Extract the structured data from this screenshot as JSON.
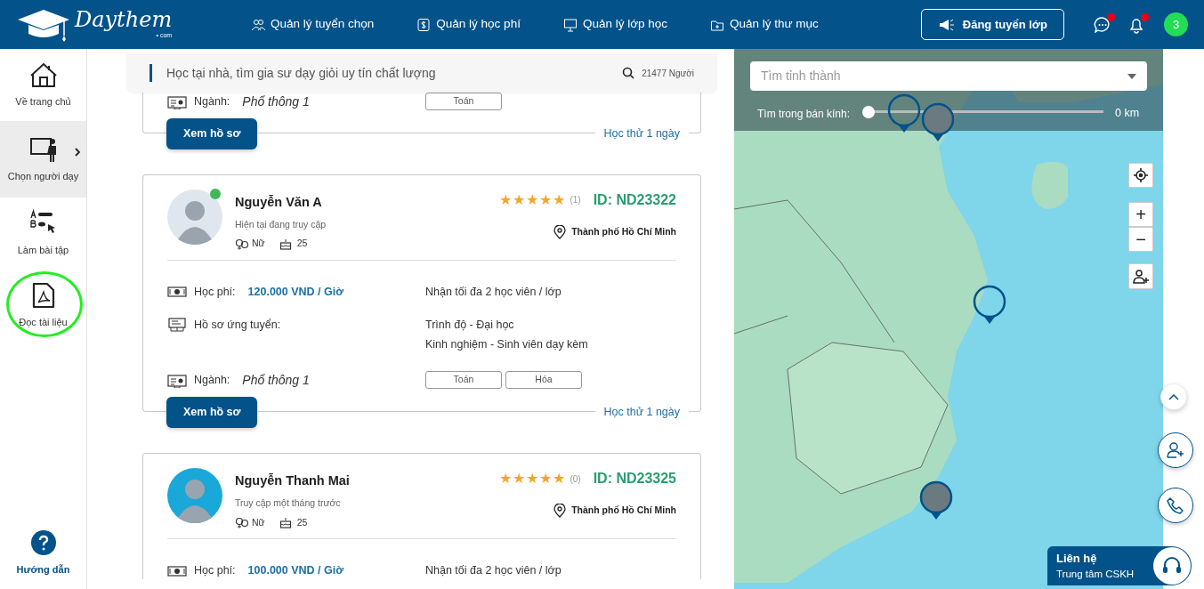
{
  "navbar": {
    "logo": "Daythem",
    "logo_suffix": "• com",
    "menu": [
      {
        "label": "Quản lý tuyển chọn",
        "kind": "people"
      },
      {
        "label": "Quản lý học phí",
        "kind": "money"
      },
      {
        "label": "Quản lý lớp học",
        "kind": "board"
      },
      {
        "label": "Quản lý thư mục",
        "kind": "folder"
      }
    ],
    "post_button": "Đăng tuyển lớp",
    "messages_unread": true,
    "notifications_unread": true,
    "avatar": "3"
  },
  "sidebar": {
    "items": [
      {
        "label": "Về trang chủ",
        "kind": "home",
        "selected": false,
        "circled": false
      },
      {
        "label": "Chọn người dạy",
        "kind": "teacher",
        "selected": true,
        "circled": false
      },
      {
        "label": "Làm bài tập",
        "kind": "quiz",
        "selected": false,
        "circled": false
      },
      {
        "label": "Đọc tài liệu",
        "kind": "pdf",
        "selected": false,
        "circled": true
      }
    ],
    "help": "Hướng dẫn"
  },
  "search": {
    "placeholder": "Học tại nhà, tìm gia sư dạy giỏi uy tín chất lượng",
    "count": "21477 Người"
  },
  "tutors": [
    {
      "major_label": "Ngành:",
      "major": "Phổ thông 1",
      "subjects": [
        "Toán"
      ],
      "button": "Xem hồ sơ",
      "trial": "Học thử 1 ngày"
    },
    {
      "name": "Nguyễn Văn A",
      "online": true,
      "status": "Hiện tại đang truy cập",
      "gender": "Nữ",
      "age": "25",
      "stars": 5,
      "reviews": "(1)",
      "id": "ID: ND23322",
      "location": "Thành phố Hồ Chí Minh",
      "fee_label": "Học phí:",
      "fee": "120.000 VND / Giờ",
      "capacity": "Nhận tối đa 2 học viên / lớp",
      "profile_label": "Hồ sơ ứng tuyển:",
      "profile": [
        "Trình độ - Đại học",
        "Kinh nghiệm - Sinh viên dạy kèm"
      ],
      "major_label": "Ngành:",
      "major": "Phổ thông 1",
      "subjects": [
        "Toán",
        "Hóa"
      ],
      "button": "Xem hồ sơ",
      "trial": "Học thử 1 ngày"
    },
    {
      "name": "Nguyễn Thanh Mai",
      "online": false,
      "status": "Truy cập một tháng trước",
      "gender": "Nữ",
      "age": "25",
      "stars": 5,
      "reviews": "(0)",
      "id": "ID: ND23325",
      "location": "Thành phố Hồ Chí Minh",
      "fee_label": "Học phí:",
      "fee": "100.000 VND / Giờ",
      "capacity": "Nhận tối đa 2 học viên / lớp"
    }
  ],
  "map": {
    "province_placeholder": "Tìm tỉnh thành",
    "radius_label": "Tìm trong bán kính:",
    "radius": {
      "level": 0
    },
    "radius_value": "0 km",
    "zoom_in": "+",
    "zoom_out": "−"
  },
  "contact": {
    "title": "Liên hệ",
    "subtitle": "Trung tâm CSKH"
  }
}
